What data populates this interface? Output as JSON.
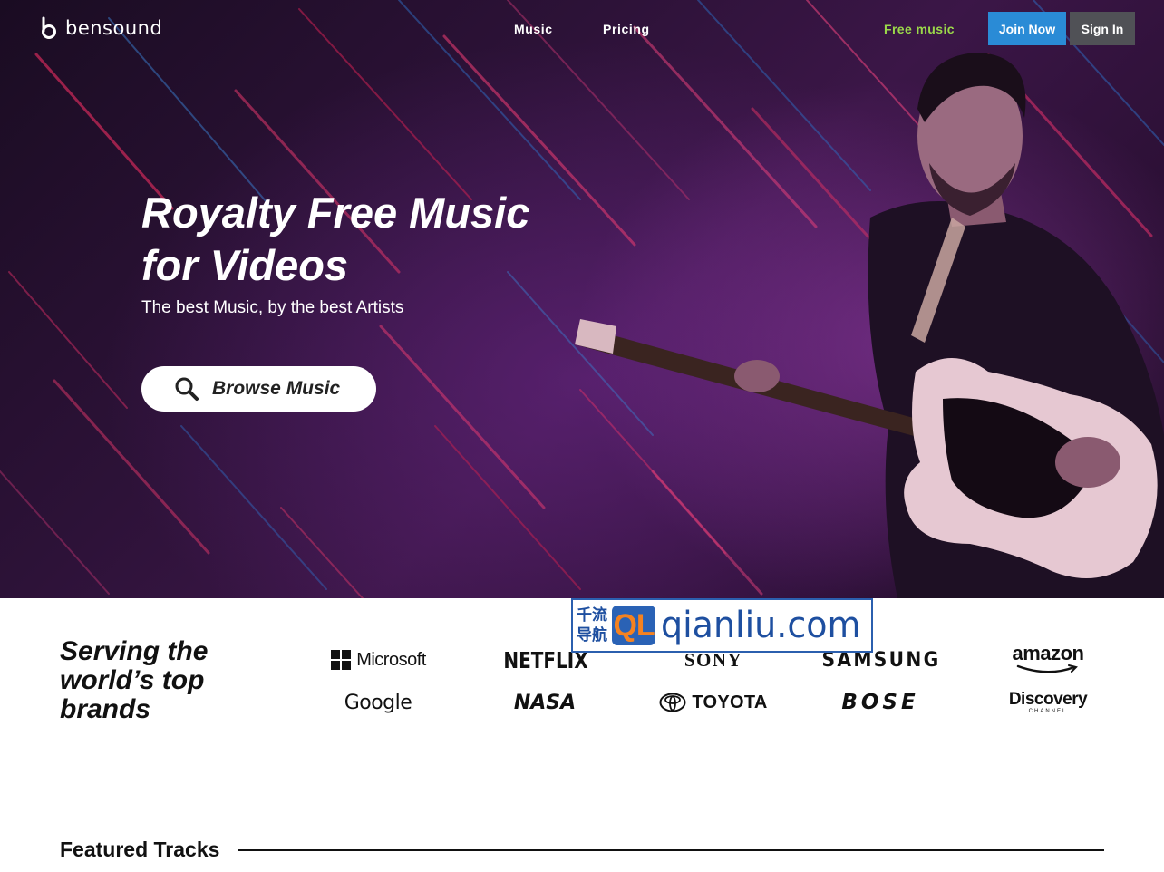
{
  "nav": {
    "logo_text": "bensound",
    "links": [
      "Music",
      "Pricing"
    ],
    "free_music": "Free music",
    "join_now": "Join Now",
    "sign_in": "Sign In"
  },
  "hero": {
    "title_line1": "Royalty Free Music",
    "title_line2": "for Videos",
    "subtitle": "The best Music, by the best Artists",
    "browse_label": "Browse Music"
  },
  "brands": {
    "heading": "Serving the world’s top brands",
    "logos": [
      "Microsoft",
      "NETFLIX",
      "SONY",
      "SAMSUNG",
      "amazon",
      "Google",
      "NASA",
      "TOYOTA",
      "BOSE",
      "Discovery"
    ],
    "discovery_sub": "CHANNEL"
  },
  "watermark": {
    "cn_line1": "千流",
    "cn_line2": "导航",
    "ql": "QL",
    "text": "qianliu.com"
  },
  "featured": {
    "title": "Featured Tracks"
  },
  "colors": {
    "join_button": "#2a8bd6",
    "sign_button": "#505156",
    "free_music": "#9bd94a"
  }
}
